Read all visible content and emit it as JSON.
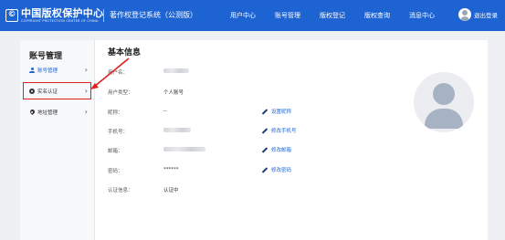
{
  "header": {
    "logo_mark": "©",
    "logo_title": "中国版权保护中心",
    "logo_subtitle": "COPYRIGHT PROTECTION CENTER OF CHINA",
    "system_name": "著作权登记系统（公测版）",
    "nav": [
      {
        "label": "用户中心"
      },
      {
        "label": "账号管理"
      },
      {
        "label": "版权登记"
      },
      {
        "label": "版权查询"
      },
      {
        "label": "消息中心"
      }
    ],
    "login_label": "退出登录"
  },
  "sidebar": {
    "title": "账号管理",
    "items": [
      {
        "label": "账号管理",
        "icon": "person-icon",
        "chevron": "›"
      },
      {
        "label": "实名认证",
        "icon": "gear-icon",
        "chevron": "›"
      },
      {
        "label": "地址管理",
        "icon": "location-pin-icon",
        "chevron": "›"
      }
    ]
  },
  "main": {
    "title": "基本信息",
    "rows": [
      {
        "label": "用户名：",
        "value": ""
      },
      {
        "label": "用户类型：",
        "value": "个人账号"
      },
      {
        "label": "昵称：",
        "value": "--",
        "action": "设置昵称"
      },
      {
        "label": "手机号：",
        "value": "",
        "action": "修改手机号"
      },
      {
        "label": "邮箱：",
        "value": "",
        "action": "修改邮箱"
      },
      {
        "label": "密码：",
        "value": "******",
        "action": "修改密码"
      },
      {
        "label": "认证信息：",
        "value": "认证中"
      }
    ]
  },
  "colors": {
    "brand": "#1d63d1",
    "highlight": "#e02020",
    "link": "#1d63d1"
  }
}
